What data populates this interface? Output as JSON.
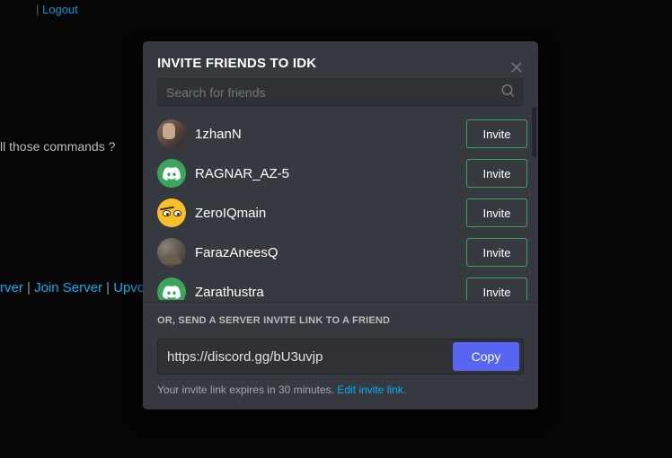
{
  "background": {
    "top_link": "",
    "top_sep": " | ",
    "top_logout": "Logout",
    "question": "ll those commands ?",
    "link1": "rver",
    "link2": "Join Server",
    "link3": "Upvote"
  },
  "modal": {
    "title": "INVITE FRIENDS TO IDK",
    "search_placeholder": "Search for friends",
    "invite_label": "Invite",
    "friends": [
      {
        "name": "1zhanN",
        "avatar": "photo1"
      },
      {
        "name": "RAGNAR_AZ-5",
        "avatar": "discord"
      },
      {
        "name": "ZeroIQmain",
        "avatar": "yellow"
      },
      {
        "name": "FarazAneesQ",
        "avatar": "photo2"
      },
      {
        "name": "Zarathustra",
        "avatar": "discord"
      }
    ],
    "footer_label": "OR, SEND A SERVER INVITE LINK TO A FRIEND",
    "invite_link": "https://discord.gg/bU3uvjp",
    "copy_label": "Copy",
    "expire_text": "Your invite link expires in 30 minutes. ",
    "edit_link_label": "Edit invite link."
  }
}
